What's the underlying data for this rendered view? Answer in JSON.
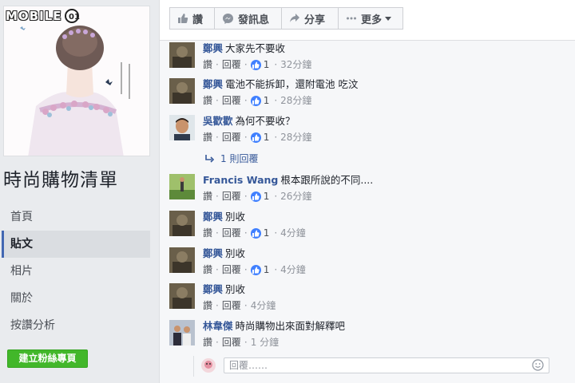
{
  "watermark": {
    "text": "MOBILE",
    "logo": "01-circle-logo"
  },
  "page": {
    "title": "時尚購物清單",
    "nav": [
      {
        "label": "首頁",
        "active": false
      },
      {
        "label": "貼文",
        "active": true
      },
      {
        "label": "相片",
        "active": false
      },
      {
        "label": "關於",
        "active": false
      },
      {
        "label": "按讚分析",
        "active": false
      }
    ],
    "create_button": "建立粉絲專頁"
  },
  "actions": {
    "like": "讚",
    "message": "發訊息",
    "share": "分享",
    "more": "更多"
  },
  "comments": [
    {
      "name": "鄭興",
      "text": "大家先不要收",
      "like_label": "讚",
      "reply_label": "回覆",
      "likes": "1",
      "time": "32分鐘"
    },
    {
      "name": "鄭興",
      "text": "電池不能拆卸，還附電池 吃汶",
      "like_label": "讚",
      "reply_label": "回覆",
      "likes": "1",
      "time": "28分鐘"
    },
    {
      "name": "吳歡歡",
      "text": "為何不要收？",
      "like_label": "讚",
      "reply_label": "回覆",
      "likes": "1",
      "time": "28分鐘"
    },
    {
      "name": "Francis Wang",
      "text": "根本跟所說的不同....",
      "like_label": "讚",
      "reply_label": "回覆",
      "likes": "1",
      "time": "26分鐘"
    },
    {
      "name": "鄭興",
      "text": "別收",
      "like_label": "讚",
      "reply_label": "回覆",
      "likes": "1",
      "time": "4分鐘"
    },
    {
      "name": "鄭興",
      "text": "別收",
      "like_label": "讚",
      "reply_label": "回覆",
      "likes": "1",
      "time": "4分鐘"
    },
    {
      "name": "鄭興",
      "text": "別收",
      "like_label": "讚",
      "reply_label": "回覆",
      "likes": "",
      "time": "4分鐘"
    },
    {
      "name": "林韋傑",
      "text": "時尚購物出來面對解釋吧",
      "like_label": "讚",
      "reply_label": "回覆",
      "likes": "",
      "time": "1 分鐘"
    }
  ],
  "replies_link": "1 則回覆",
  "reply_box": {
    "placeholder": "回覆……"
  },
  "colors": {
    "link": "#365899",
    "like_blue": "#4080ff",
    "green": "#42b72a"
  }
}
